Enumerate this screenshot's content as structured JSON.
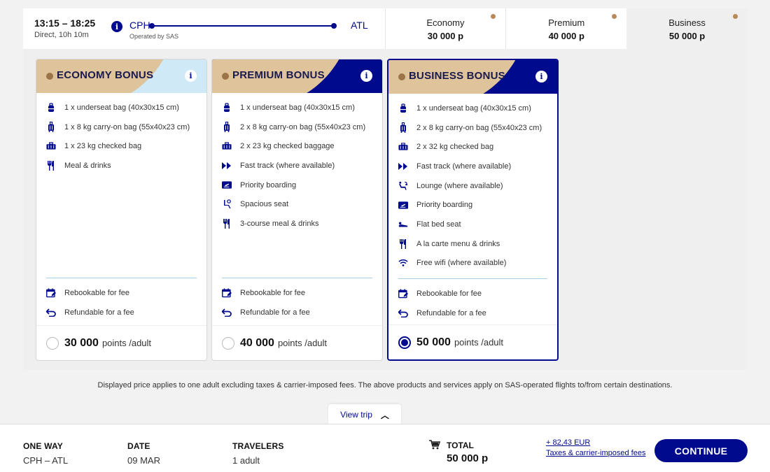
{
  "flight": {
    "times": "13:15 – 18:25",
    "duration": "Direct, 10h 10m",
    "origin": "CPH",
    "destination": "ATL",
    "operated_by": "Operated by SAS"
  },
  "cabins": [
    {
      "name": "Economy",
      "price": "30 000 p"
    },
    {
      "name": "Premium",
      "price": "40 000 p"
    },
    {
      "name": "Business",
      "price": "50 000 p"
    }
  ],
  "fares": [
    {
      "title": "ECONOMY BONUS",
      "features": [
        {
          "icon": "bag-icon",
          "text": "1 x underseat bag (40x30x15 cm)"
        },
        {
          "icon": "carry-on-icon",
          "text": "1 x 8 kg carry-on bag (55x40x23 cm)"
        },
        {
          "icon": "checked-bag-icon",
          "text": "1 x 23 kg checked bag"
        },
        {
          "icon": "meal-icon",
          "text": "Meal & drinks"
        }
      ],
      "terms": [
        {
          "icon": "calendar-edit-icon",
          "text": "Rebookable for fee"
        },
        {
          "icon": "refund-icon",
          "text": "Refundable for a fee"
        }
      ],
      "points": "30 000",
      "points_unit": "points /adult"
    },
    {
      "title": "PREMIUM BONUS",
      "features": [
        {
          "icon": "bag-icon",
          "text": "1 x underseat bag (40x30x15 cm)"
        },
        {
          "icon": "carry-on-icon",
          "text": "2 x 8 kg carry-on bag (55x40x23 cm)"
        },
        {
          "icon": "checked-bag-icon",
          "text": "2 x 23 kg checked baggage"
        },
        {
          "icon": "fast-track-icon",
          "text": "Fast track (where available)"
        },
        {
          "icon": "boarding-pass-icon",
          "text": "Priority boarding"
        },
        {
          "icon": "seat-icon",
          "text": "Spacious seat"
        },
        {
          "icon": "meal-icon",
          "text": "3-course meal & drinks"
        }
      ],
      "terms": [
        {
          "icon": "calendar-edit-icon",
          "text": "Rebookable for fee"
        },
        {
          "icon": "refund-icon",
          "text": "Refundable for a fee"
        }
      ],
      "points": "40 000",
      "points_unit": "points /adult"
    },
    {
      "title": "BUSINESS BONUS",
      "features": [
        {
          "icon": "bag-icon",
          "text": "1 x underseat bag (40x30x15 cm)"
        },
        {
          "icon": "carry-on-icon",
          "text": "2 x 8 kg carry-on bag (55x40x23 cm)"
        },
        {
          "icon": "checked-bag-icon",
          "text": "2 x 32 kg checked bag"
        },
        {
          "icon": "fast-track-icon",
          "text": "Fast track (where available)"
        },
        {
          "icon": "lounge-icon",
          "text": "Lounge (where available)"
        },
        {
          "icon": "boarding-pass-icon",
          "text": "Priority boarding"
        },
        {
          "icon": "flat-bed-icon",
          "text": "Flat bed seat"
        },
        {
          "icon": "meal-icon",
          "text": "A la carte menu & drinks"
        },
        {
          "icon": "wifi-icon",
          "text": "Free wifi (where available)"
        }
      ],
      "terms": [
        {
          "icon": "calendar-edit-icon",
          "text": "Rebookable for fee"
        },
        {
          "icon": "refund-icon",
          "text": "Refundable for a fee"
        }
      ],
      "points": "50 000",
      "points_unit": "points /adult"
    }
  ],
  "disclaimer": "Displayed price applies to one adult excluding taxes & carrier-imposed fees. The above products and services apply on SAS-operated flights to/from certain destinations.",
  "view_trip": "View trip",
  "summary": {
    "trip_type_label": "ONE WAY",
    "trip_route": "CPH – ATL",
    "date_label": "DATE",
    "date_value": "09 MAR",
    "travelers_label": "TRAVELERS",
    "travelers_value": "1 adult",
    "total_label": "TOTAL",
    "total_value": "50 000 p",
    "fees_amount": "+ 82,43 EUR",
    "fees_label": "Taxes & carrier-imposed fees",
    "continue_label": "CONTINUE"
  },
  "colors": {
    "brand": "#000a8c",
    "accent_tan": "#dec39b",
    "economy_header": "#cfe9f6"
  }
}
